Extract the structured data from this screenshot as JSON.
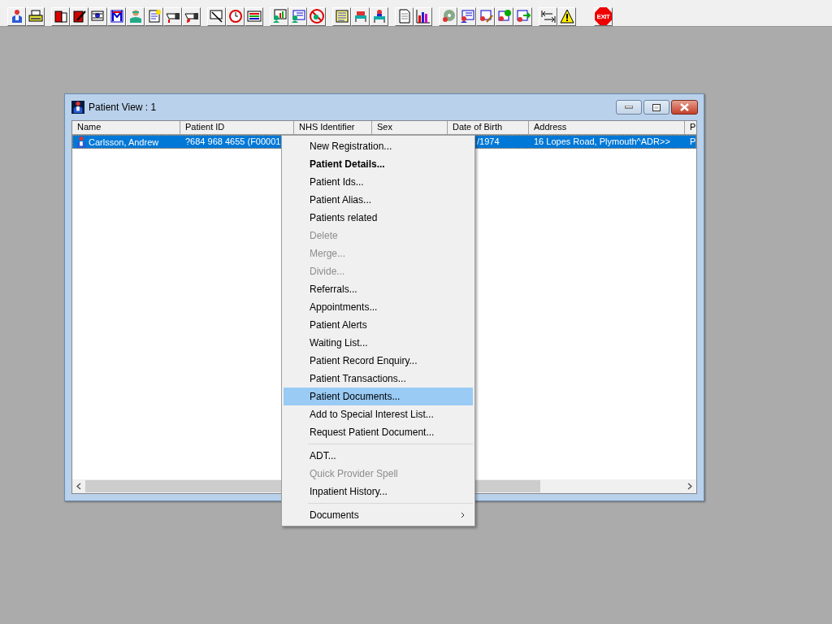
{
  "toolbar": {
    "exit_label": "EXIT"
  },
  "window": {
    "title": "Patient View : 1"
  },
  "table": {
    "columns": [
      "Name",
      "Patient ID",
      "NHS Identifier",
      "Sex",
      "Date of Birth",
      "Address",
      "P"
    ],
    "rows": [
      {
        "selected": true,
        "name": "Carlsson, Andrew",
        "patient_id": "?684 968 4655 (F00001",
        "date_of_birth": "/1974",
        "address": "16 Lopes Road, Plymouth^ADR>>",
        "column_7": "P"
      }
    ]
  },
  "context_menu": {
    "items": [
      {
        "kind": "item",
        "label": "New Registration...",
        "default": false,
        "disabled": false,
        "selected": false
      },
      {
        "kind": "item",
        "label": "Patient Details...",
        "default": true,
        "disabled": false,
        "selected": false
      },
      {
        "kind": "item",
        "label": "Patient Ids...",
        "default": false,
        "disabled": false,
        "selected": false
      },
      {
        "kind": "item",
        "label": "Patient Alias...",
        "default": false,
        "disabled": false,
        "selected": false
      },
      {
        "kind": "item",
        "label": "Patients related",
        "default": false,
        "disabled": false,
        "selected": false
      },
      {
        "kind": "item",
        "label": "Delete",
        "default": false,
        "disabled": true,
        "selected": false
      },
      {
        "kind": "item",
        "label": "Merge...",
        "default": false,
        "disabled": true,
        "selected": false
      },
      {
        "kind": "item",
        "label": "Divide...",
        "default": false,
        "disabled": true,
        "selected": false
      },
      {
        "kind": "item",
        "label": "Referrals...",
        "default": false,
        "disabled": false,
        "selected": false
      },
      {
        "kind": "item",
        "label": "Appointments...",
        "default": false,
        "disabled": false,
        "selected": false
      },
      {
        "kind": "item",
        "label": "Patient Alerts",
        "default": false,
        "disabled": false,
        "selected": false
      },
      {
        "kind": "item",
        "label": "Waiting List...",
        "default": false,
        "disabled": false,
        "selected": false
      },
      {
        "kind": "item",
        "label": "Patient Record Enquiry...",
        "default": false,
        "disabled": false,
        "selected": false
      },
      {
        "kind": "item",
        "label": "Patient Transactions...",
        "default": false,
        "disabled": false,
        "selected": false
      },
      {
        "kind": "item",
        "label": "Patient Documents...",
        "default": false,
        "disabled": false,
        "selected": true
      },
      {
        "kind": "item",
        "label": "Add to Special Interest List...",
        "default": false,
        "disabled": false,
        "selected": false
      },
      {
        "kind": "item",
        "label": "Request Patient Document...",
        "default": false,
        "disabled": false,
        "selected": false
      },
      {
        "kind": "separator"
      },
      {
        "kind": "item",
        "label": "ADT...",
        "default": false,
        "disabled": false,
        "selected": false
      },
      {
        "kind": "item",
        "label": "Quick Provider Spell",
        "default": false,
        "disabled": true,
        "selected": false
      },
      {
        "kind": "item",
        "label": "Inpatient History...",
        "default": false,
        "disabled": false,
        "selected": false
      },
      {
        "kind": "separator"
      },
      {
        "kind": "submenu",
        "label": "Documents",
        "default": false,
        "disabled": false,
        "selected": false
      }
    ]
  }
}
